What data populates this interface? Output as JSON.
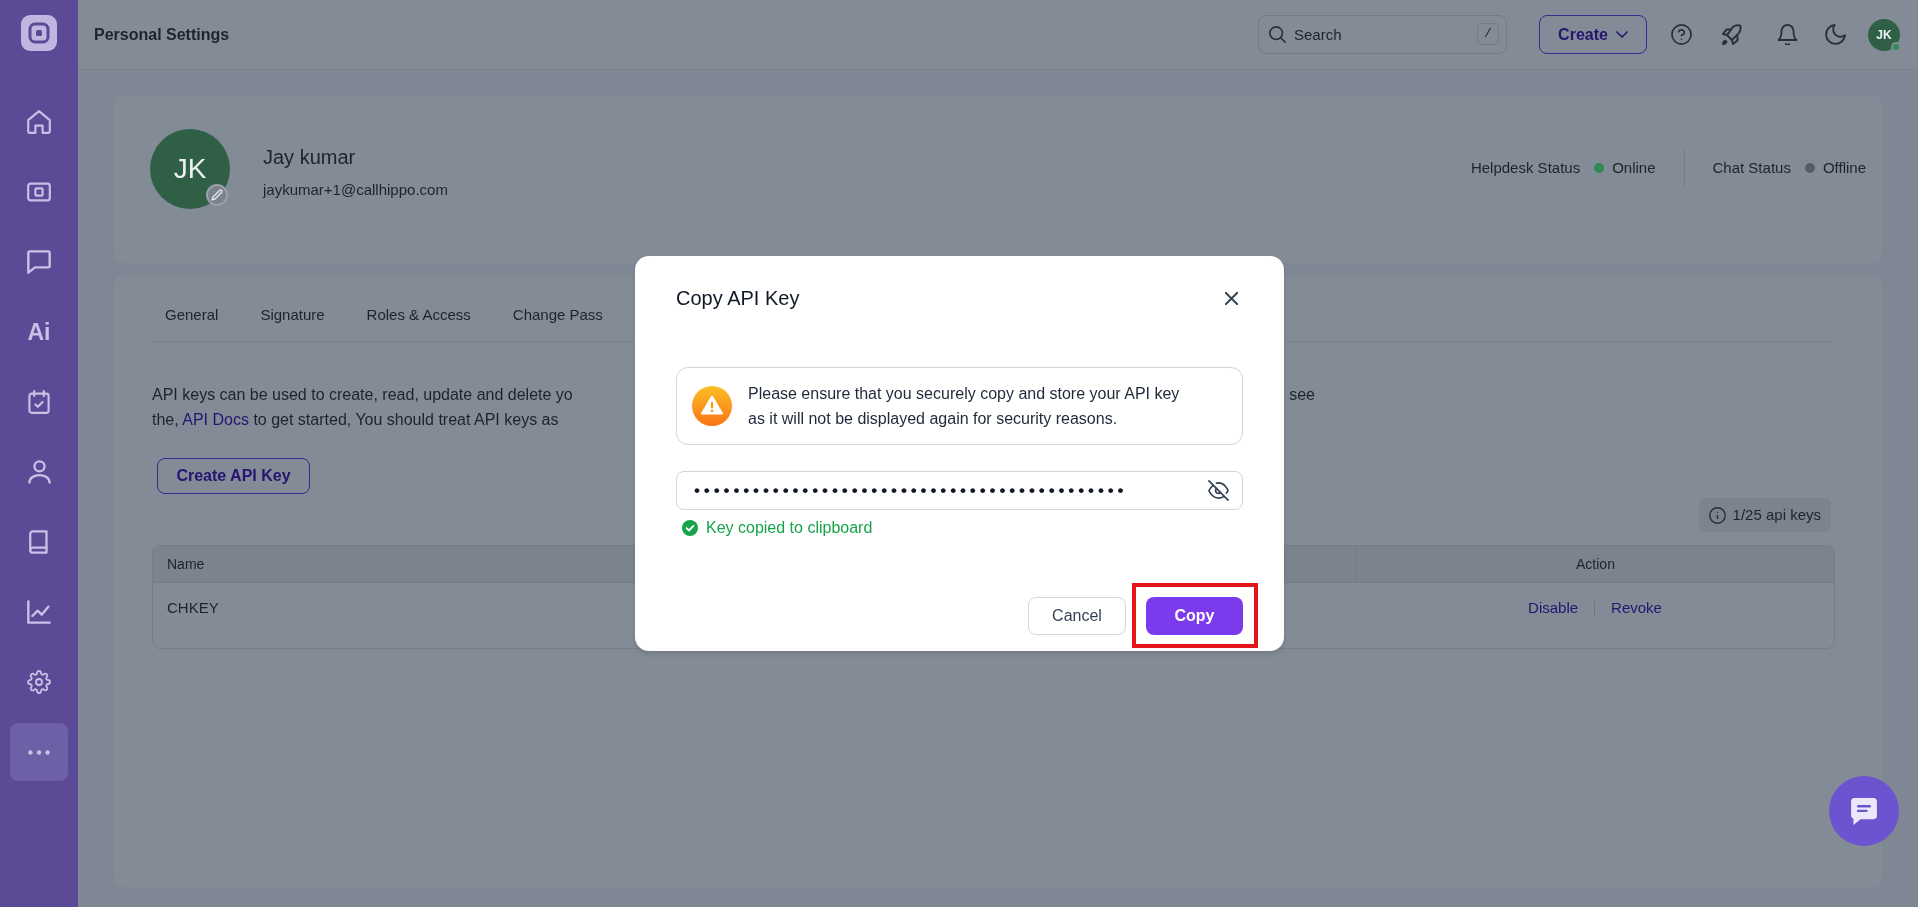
{
  "sidebar": {
    "items": [
      {
        "kind": "icon",
        "selected": false
      },
      {
        "kind": "icon",
        "selected": false
      },
      {
        "kind": "icon",
        "selected": false
      },
      {
        "kind": "text",
        "label": "Ai",
        "selected": false
      },
      {
        "kind": "icon",
        "selected": false
      },
      {
        "kind": "icon",
        "selected": false
      },
      {
        "kind": "icon",
        "selected": false
      },
      {
        "kind": "icon",
        "selected": false
      },
      {
        "kind": "icon",
        "selected": false
      },
      {
        "kind": "icon",
        "selected": true
      }
    ]
  },
  "topbar": {
    "title": "Personal Settings",
    "search": {
      "placeholder": "Search",
      "shortcut": "/"
    },
    "create_button": "Create",
    "avatar": {
      "initials": "JK",
      "online": true
    }
  },
  "profile": {
    "initials": "JK",
    "name": "Jay kumar",
    "email": "jaykumar+1@callhippo.com",
    "statuses": [
      {
        "label": "Helpdesk Status",
        "value": "Online",
        "color": "#2f8a56"
      },
      {
        "label": "Chat Status",
        "value": "Offline",
        "color": "#565d68"
      }
    ]
  },
  "tabs": [
    {
      "label": "General",
      "selected": false
    },
    {
      "label": "Signature",
      "selected": false
    },
    {
      "label": "Roles & Access",
      "selected": false
    },
    {
      "label": "Change Pass",
      "selected": false
    }
  ],
  "description": {
    "line_1": "API keys can be used to create, read, update and delete yo",
    "line_1_end": "see",
    "line_2_before_link": "the,",
    "link": "API Docs",
    "line_2_after_link": "to get started, You should treat API keys as"
  },
  "create_api_key_button": "Create API Key",
  "key_count": "1/25 api keys",
  "table": {
    "columns": [
      "Name",
      "Action"
    ],
    "rows": [
      {
        "name": "CHKEY",
        "actions": [
          "Disable",
          "Revoke"
        ]
      }
    ]
  },
  "dialog": {
    "title": "Copy API Key",
    "warning": "Please ensure that you securely copy and store your API key as it will not be displayed again for security reasons.",
    "key_field": {
      "value": "••••••••••••••••••••••••••••••••••••••••••••",
      "revealed": false
    },
    "success": "Key copied to clipboard",
    "buttons": [
      {
        "label": "Cancel",
        "kind": "secondary",
        "highlighted": false
      },
      {
        "label": "Copy",
        "kind": "primary",
        "highlighted": true
      }
    ]
  }
}
